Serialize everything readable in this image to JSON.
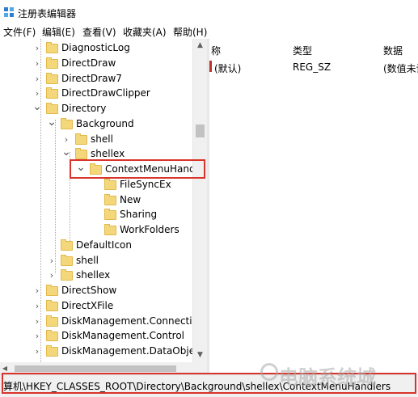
{
  "window": {
    "title": "注册表编辑器",
    "app_icon": "registry-editor-icon"
  },
  "menu": [
    "文件(F)",
    "编辑(E)",
    "查看(V)",
    "收藏夹(A)",
    "帮助(H)"
  ],
  "tree": [
    {
      "label": "DiagnosticLog",
      "expander": "right",
      "selected": false
    },
    {
      "label": "DirectDraw",
      "expander": "right",
      "selected": false
    },
    {
      "label": "DirectDraw7",
      "expander": "right",
      "selected": false
    },
    {
      "label": "DirectDrawClipper",
      "expander": "right",
      "selected": false
    },
    {
      "label": "Directory",
      "expander": "down",
      "selected": false
    },
    {
      "label": "Background",
      "expander": "down",
      "selected": false
    },
    {
      "label": "shell",
      "expander": "right",
      "selected": false
    },
    {
      "label": "shellex",
      "expander": "down",
      "selected": false
    },
    {
      "label": "ContextMenuHandle",
      "expander": "down",
      "selected": true
    },
    {
      "label": "FileSyncEx",
      "expander": "none",
      "selected": false
    },
    {
      "label": "New",
      "expander": "none",
      "selected": false
    },
    {
      "label": "Sharing",
      "expander": "none",
      "selected": false
    },
    {
      "label": "WorkFolders",
      "expander": "none",
      "selected": false
    },
    {
      "label": "DefaultIcon",
      "expander": "none",
      "selected": false
    },
    {
      "label": "shell",
      "expander": "right",
      "selected": false
    },
    {
      "label": "shellex",
      "expander": "right",
      "selected": false
    },
    {
      "label": "DirectShow",
      "expander": "right",
      "selected": false
    },
    {
      "label": "DirectXFile",
      "expander": "right",
      "selected": false
    },
    {
      "label": "DiskManagement.Connection",
      "expander": "right",
      "selected": false
    },
    {
      "label": "DiskManagement.Control",
      "expander": "right",
      "selected": false
    },
    {
      "label": "DiskManagement.DataObject",
      "expander": "right",
      "selected": false
    }
  ],
  "values_pane": {
    "headers": {
      "name": "称",
      "type": "类型",
      "data": "数据"
    },
    "rows": [
      {
        "name": "(默认)",
        "type": "REG_SZ",
        "data": "(数值未设"
      }
    ]
  },
  "status": {
    "path": "算机\\HKEY_CLASSES_ROOT\\Directory\\Background\\shellex\\ContextMenuHandlers"
  },
  "watermark": "电脑系统城",
  "colors": {
    "highlight": "#d9342b",
    "folder": "#f4d77a"
  }
}
